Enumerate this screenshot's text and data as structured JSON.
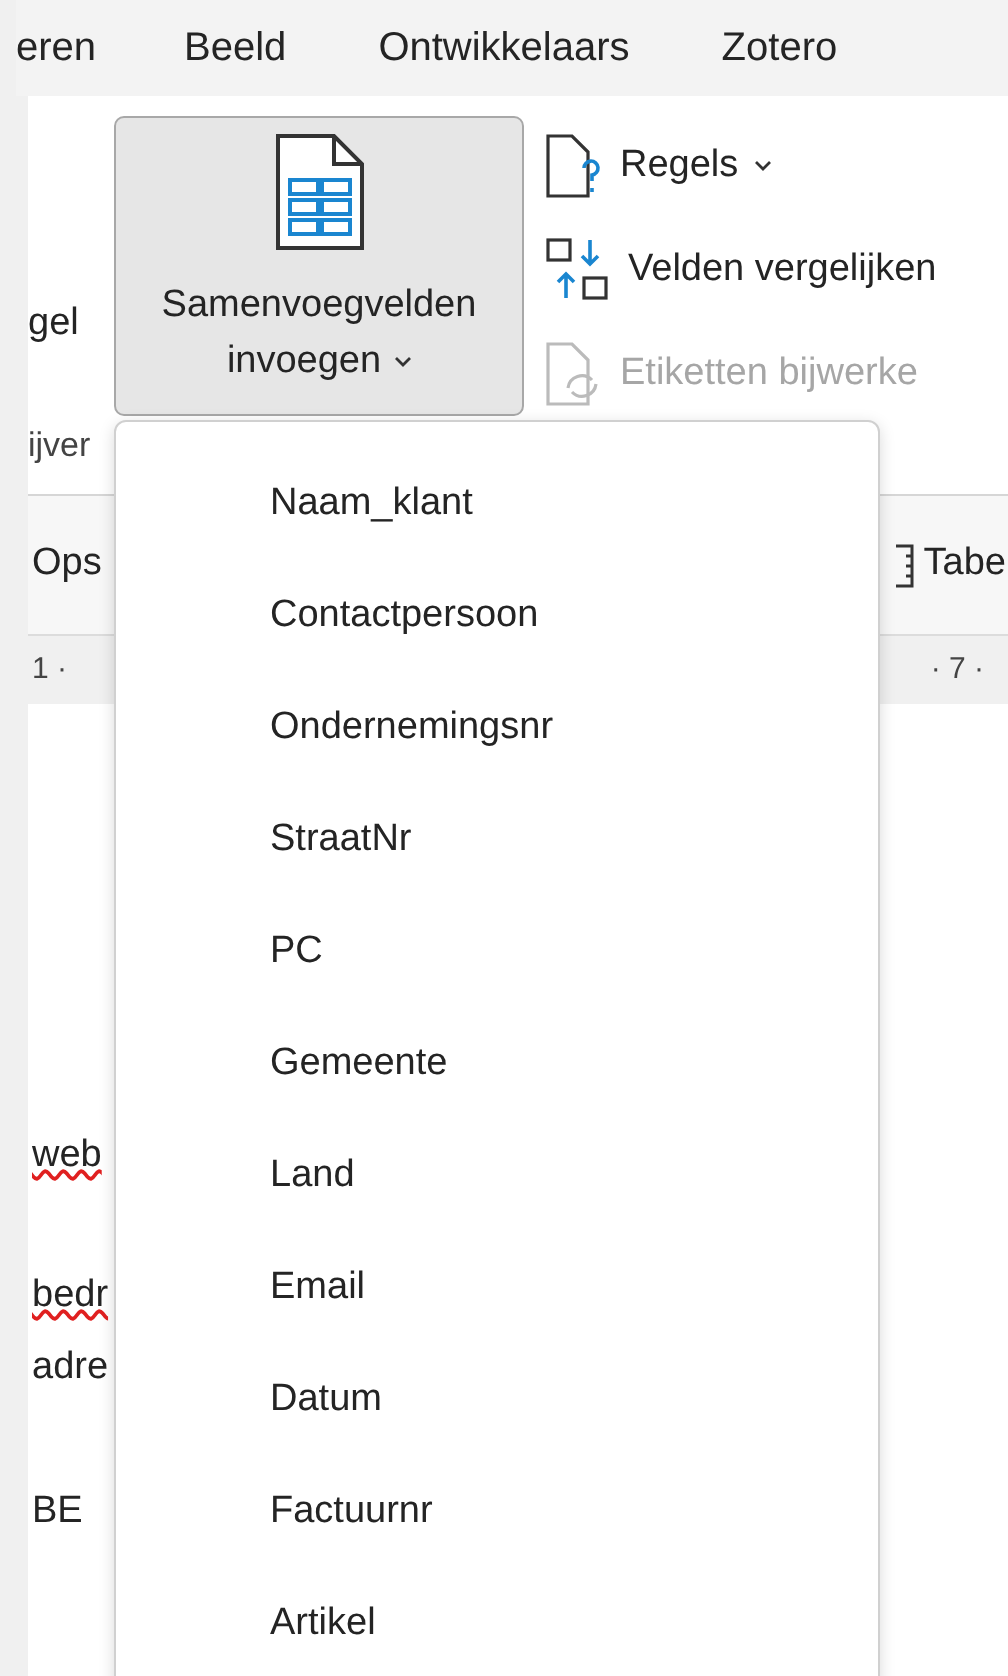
{
  "menu_bar": {
    "tabs": [
      {
        "label": "eren"
      },
      {
        "label": "Beeld"
      },
      {
        "label": "Ontwikkelaars"
      },
      {
        "label": "Zotero"
      }
    ]
  },
  "ribbon": {
    "left_label": "gel",
    "insert_button": {
      "line_1": "Samenvoegvelden",
      "line_2": "invoegen",
      "expanded": true
    },
    "commands": [
      {
        "kind": "rules",
        "label": "Regels",
        "has_caret": true,
        "disabled": false
      },
      {
        "kind": "compare",
        "label": "Velden vergelijken",
        "has_caret": false,
        "disabled": false
      },
      {
        "kind": "update",
        "label": "Etiketten bijwerke",
        "has_caret": false,
        "disabled": true
      }
    ],
    "group_label": "ijver"
  },
  "toolbar": {
    "left_label": "Ops",
    "right_label": "Tabe"
  },
  "ruler": {
    "left_mark": "1 ·",
    "right_mark": "· 7 ·"
  },
  "document_lines": [
    {
      "text": "web",
      "spelling_error": true
    },
    {
      "text": "bedr",
      "spelling_error": true
    },
    {
      "text": "adre",
      "spelling_error": false
    },
    {
      "text": "BE",
      "spelling_error": false
    }
  ],
  "dropdown": {
    "items": [
      {
        "label": "Naam_klant"
      },
      {
        "label": "Contactpersoon"
      },
      {
        "label": "Ondernemingsnr"
      },
      {
        "label": "StraatNr"
      },
      {
        "label": "PC"
      },
      {
        "label": "Gemeente"
      },
      {
        "label": "Land"
      },
      {
        "label": "Email"
      },
      {
        "label": "Datum"
      },
      {
        "label": "Factuurnr"
      },
      {
        "label": "Artikel"
      }
    ]
  }
}
